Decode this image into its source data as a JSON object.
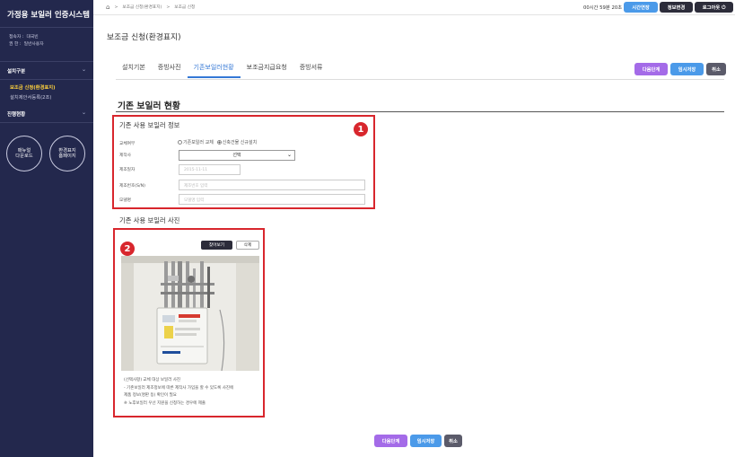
{
  "sidebar": {
    "title": "가정용 보일러 인증시스템",
    "user": {
      "line1_label": "접속자 :",
      "line1_value": "대국빈",
      "line2_label": "권  한 :",
      "line2_value": "일반사용자"
    },
    "group1": {
      "label": "설치구분",
      "items": [
        "보조금 신청(환경표지)",
        "설치제안서등록(2조)"
      ]
    },
    "group2": {
      "label": "진행현황"
    },
    "circles": [
      "매뉴얼\n다운로드",
      "환경표지\n홈페이지"
    ]
  },
  "topbar": {
    "breadcrumb": [
      "보조금 신청(환경표지)",
      "보조금 신청"
    ],
    "timer": "00시간 59분 20초",
    "buttons": {
      "extend": "시간연장",
      "info": "정보변경",
      "logout": "로그아웃 ⏻"
    },
    "colors": {
      "extend": "#4b9ae9",
      "info": "#2c2c3a",
      "logout": "#2c2c3a"
    }
  },
  "page_title": "보조금 신청(환경표지)",
  "tabs": [
    "설치기본",
    "증빙사진",
    "기존보일러현황",
    "보조금지급요청",
    "증빙서류"
  ],
  "active_tab": "기존보일러현황",
  "actions": {
    "next": "다음단계",
    "save": "임시저장",
    "cancel": "취소"
  },
  "section_title": "기존 보일러 현황",
  "info_box": {
    "marker": "1",
    "title": "기존 사용 보일러 정보",
    "fields": {
      "type_label": "교체여부",
      "radio1": "기존보일러 교체",
      "radio2": "신축건물 신규설치",
      "maker_label": "제작사",
      "maker_value": "선택",
      "date_label": "제조일자",
      "date_placeholder": "2015-11-11",
      "serial_label": "제조번호(S/N)",
      "serial_placeholder": "제조번호 입력",
      "model_label": "모델명",
      "model_placeholder": "모델명 입력"
    }
  },
  "photo_box": {
    "marker": "2",
    "title": "기존 사용 보일러 사진",
    "browse": "찾아보기",
    "delete": "삭제",
    "notes": [
      "(선택사항) 교체 대상 보일러 사진",
      "- 기존보일러 제조정보에 따른 제작사 가입을 할 수 있도록 사진에",
      "  제품 정보(명판 등) 확인이 필요",
      "※ 노후보일러 우선 지원을 신청하는 경우에 제출"
    ]
  }
}
